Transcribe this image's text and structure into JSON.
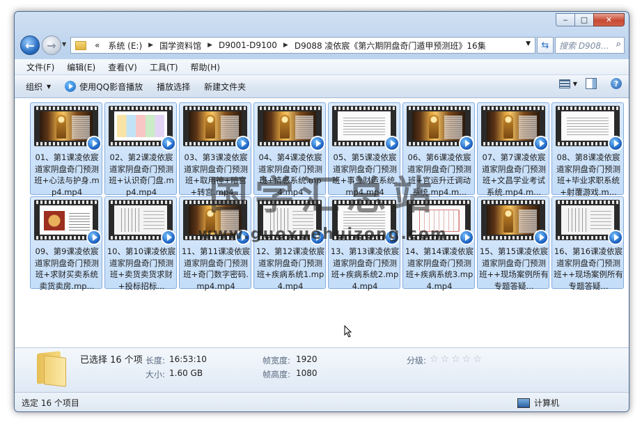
{
  "window": {
    "caption": {
      "minimize": "‒",
      "maximize": "□",
      "close": "✕"
    }
  },
  "nav": {
    "back_icon": "back-arrow-icon",
    "forward_icon": "forward-arrow-icon",
    "address": {
      "prefix": "«",
      "crumbs": [
        "系统 (E:)",
        "国学资料馆",
        "D9001-D9100",
        "D9088 凌依宸《第六期阴盘奇门遁甲预测班》16集"
      ]
    },
    "search_placeholder": "搜索 D908..."
  },
  "menu": [
    "文件(F)",
    "编辑(E)",
    "查看(V)",
    "工具(T)",
    "帮助(H)"
  ],
  "toolbar": {
    "organize": "组织",
    "play_qq": "使用QQ影音播放",
    "play_selection": "播放选择",
    "new_folder": "新建文件夹"
  },
  "files": [
    {
      "name": "01、第1课凌依宸道家阴盘奇门预测班+心法与护身.mp4.mp4",
      "thumb": "temple"
    },
    {
      "name": "02、第2课凌依宸道家阴盘奇门预测班+认识奇门盘.mp4.mp4",
      "thumb": "table"
    },
    {
      "name": "03、第3课凌依宸道家阴盘奇门预测班+取用神+暗宫+转宫.mp4...",
      "thumb": "temple"
    },
    {
      "name": "04、第4课凌依宸道家阴盘奇门预测班+情感系统.mp4.mp4",
      "thumb": "temple"
    },
    {
      "name": "05、第5课凌依宸道家阴盘奇门预测班+事业财运系统.mp4.mp4",
      "thumb": "doc"
    },
    {
      "name": "06、第6课凌依宸道家阴盘奇门预测班+官运升迁调动系统.mp4.m...",
      "thumb": "temple"
    },
    {
      "name": "07、第7课凌依宸道家阴盘奇门预测班+文昌学业考试系统.mp4.m...",
      "thumb": "temple"
    },
    {
      "name": "08、第8课凌依宸道家阴盘奇门预测班+毕业求职系统+射覆游戏.m...",
      "thumb": "doc"
    },
    {
      "name": "09、第9课凌依宸道家阴盘奇门预测班+求财买卖系统卖货卖房.mp...",
      "thumb": "redlogo"
    },
    {
      "name": "10、第10课凌依宸道家阴盘奇门预测班+卖货卖货求财+投标招标...",
      "thumb": "board"
    },
    {
      "name": "11、第11课凌依宸道家阴盘奇门预测班+奇门数字密码.mp4.mp4",
      "thumb": "temple"
    },
    {
      "name": "12、第12课凌依宸道家阴盘奇门预测班+疾病系统1.mp4.mp4",
      "thumb": "board"
    },
    {
      "name": "13、第13课凌依宸道家阴盘奇门预测班+疾病系统2.mp4.mp4",
      "thumb": "doc"
    },
    {
      "name": "14、第14课凌依宸道家阴盘奇门预测班+疾病系统3.mp4.mp4",
      "thumb": "chart"
    },
    {
      "name": "15、第15课凌依宸道家阴盘奇门预测班++现场案例所有专题答疑...",
      "thumb": "temple"
    },
    {
      "name": "16、第16课凌依宸道家阴盘奇门预测班++现场案例所有专题答疑...",
      "thumb": "board"
    }
  ],
  "watermark": {
    "cn": "国学汇总站",
    "url": "www.guoxuehuizong.com"
  },
  "details": {
    "selected": "已选择 16 个项",
    "length_label": "长度:",
    "length_value": "16:53:10",
    "size_label": "大小:",
    "size_value": "1.60 GB",
    "frame_width_label": "帧宽度:",
    "frame_width_value": "1920",
    "frame_height_label": "帧高度:",
    "frame_height_value": "1080",
    "rating_label": "分级:",
    "rating_stars": "☆☆☆☆☆"
  },
  "status": {
    "left": "选定 16 个项目",
    "right": "计算机"
  }
}
